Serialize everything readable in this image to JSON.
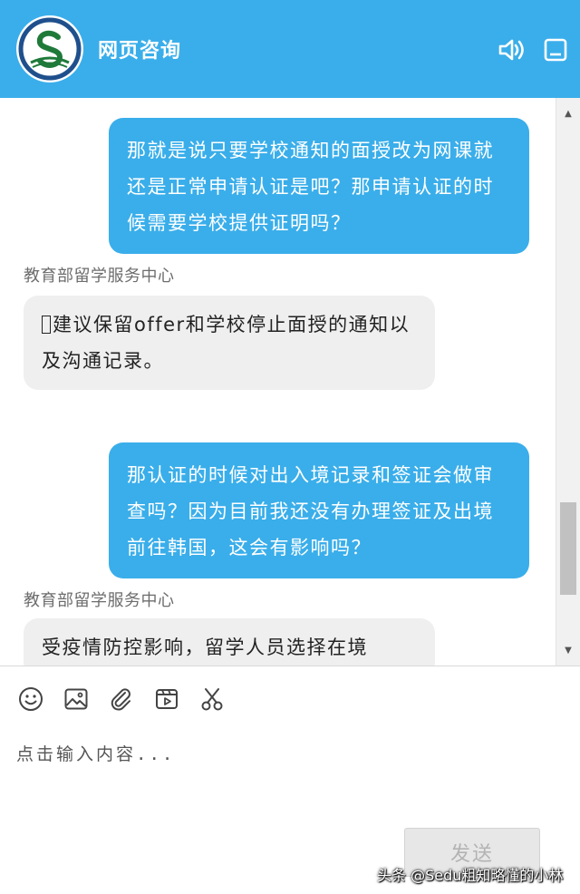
{
  "header": {
    "title": "网页咨询",
    "logo_icon": "organization-logo",
    "sound_icon": "speaker-icon",
    "minimize_icon": "minimize-icon",
    "bg_color": "#3aaeea"
  },
  "messages": [
    {
      "direction": "outgoing",
      "text": "那就是说只要学校通知的面授改为网课就还是正常申请认证是吧？那申请认证的时候需要学校提供证明吗？"
    },
    {
      "direction": "incoming",
      "sender": "教育部留学服务中心",
      "text": "建议保留offer和学校停止面授的通知以及沟通记录。"
    },
    {
      "direction": "outgoing",
      "text": "那认证的时候对出入境记录和签证会做审查吗？因为目前我还没有办理签证及出境前往韩国，这会有影响吗？"
    },
    {
      "direction": "incoming",
      "sender": "教育部留学服务中心",
      "text": "受疫情防控影响，留学人员选择在境"
    }
  ],
  "toolbar": {
    "icons": [
      "emoji-icon",
      "image-icon",
      "attachment-icon",
      "video-icon",
      "screenshot-scissors-icon"
    ]
  },
  "input": {
    "placeholder": "点击输入内容...",
    "value": ""
  },
  "send_button": {
    "label": "发送"
  },
  "watermark": {
    "text": "头条 @Sedu粗知略懂的小林"
  }
}
